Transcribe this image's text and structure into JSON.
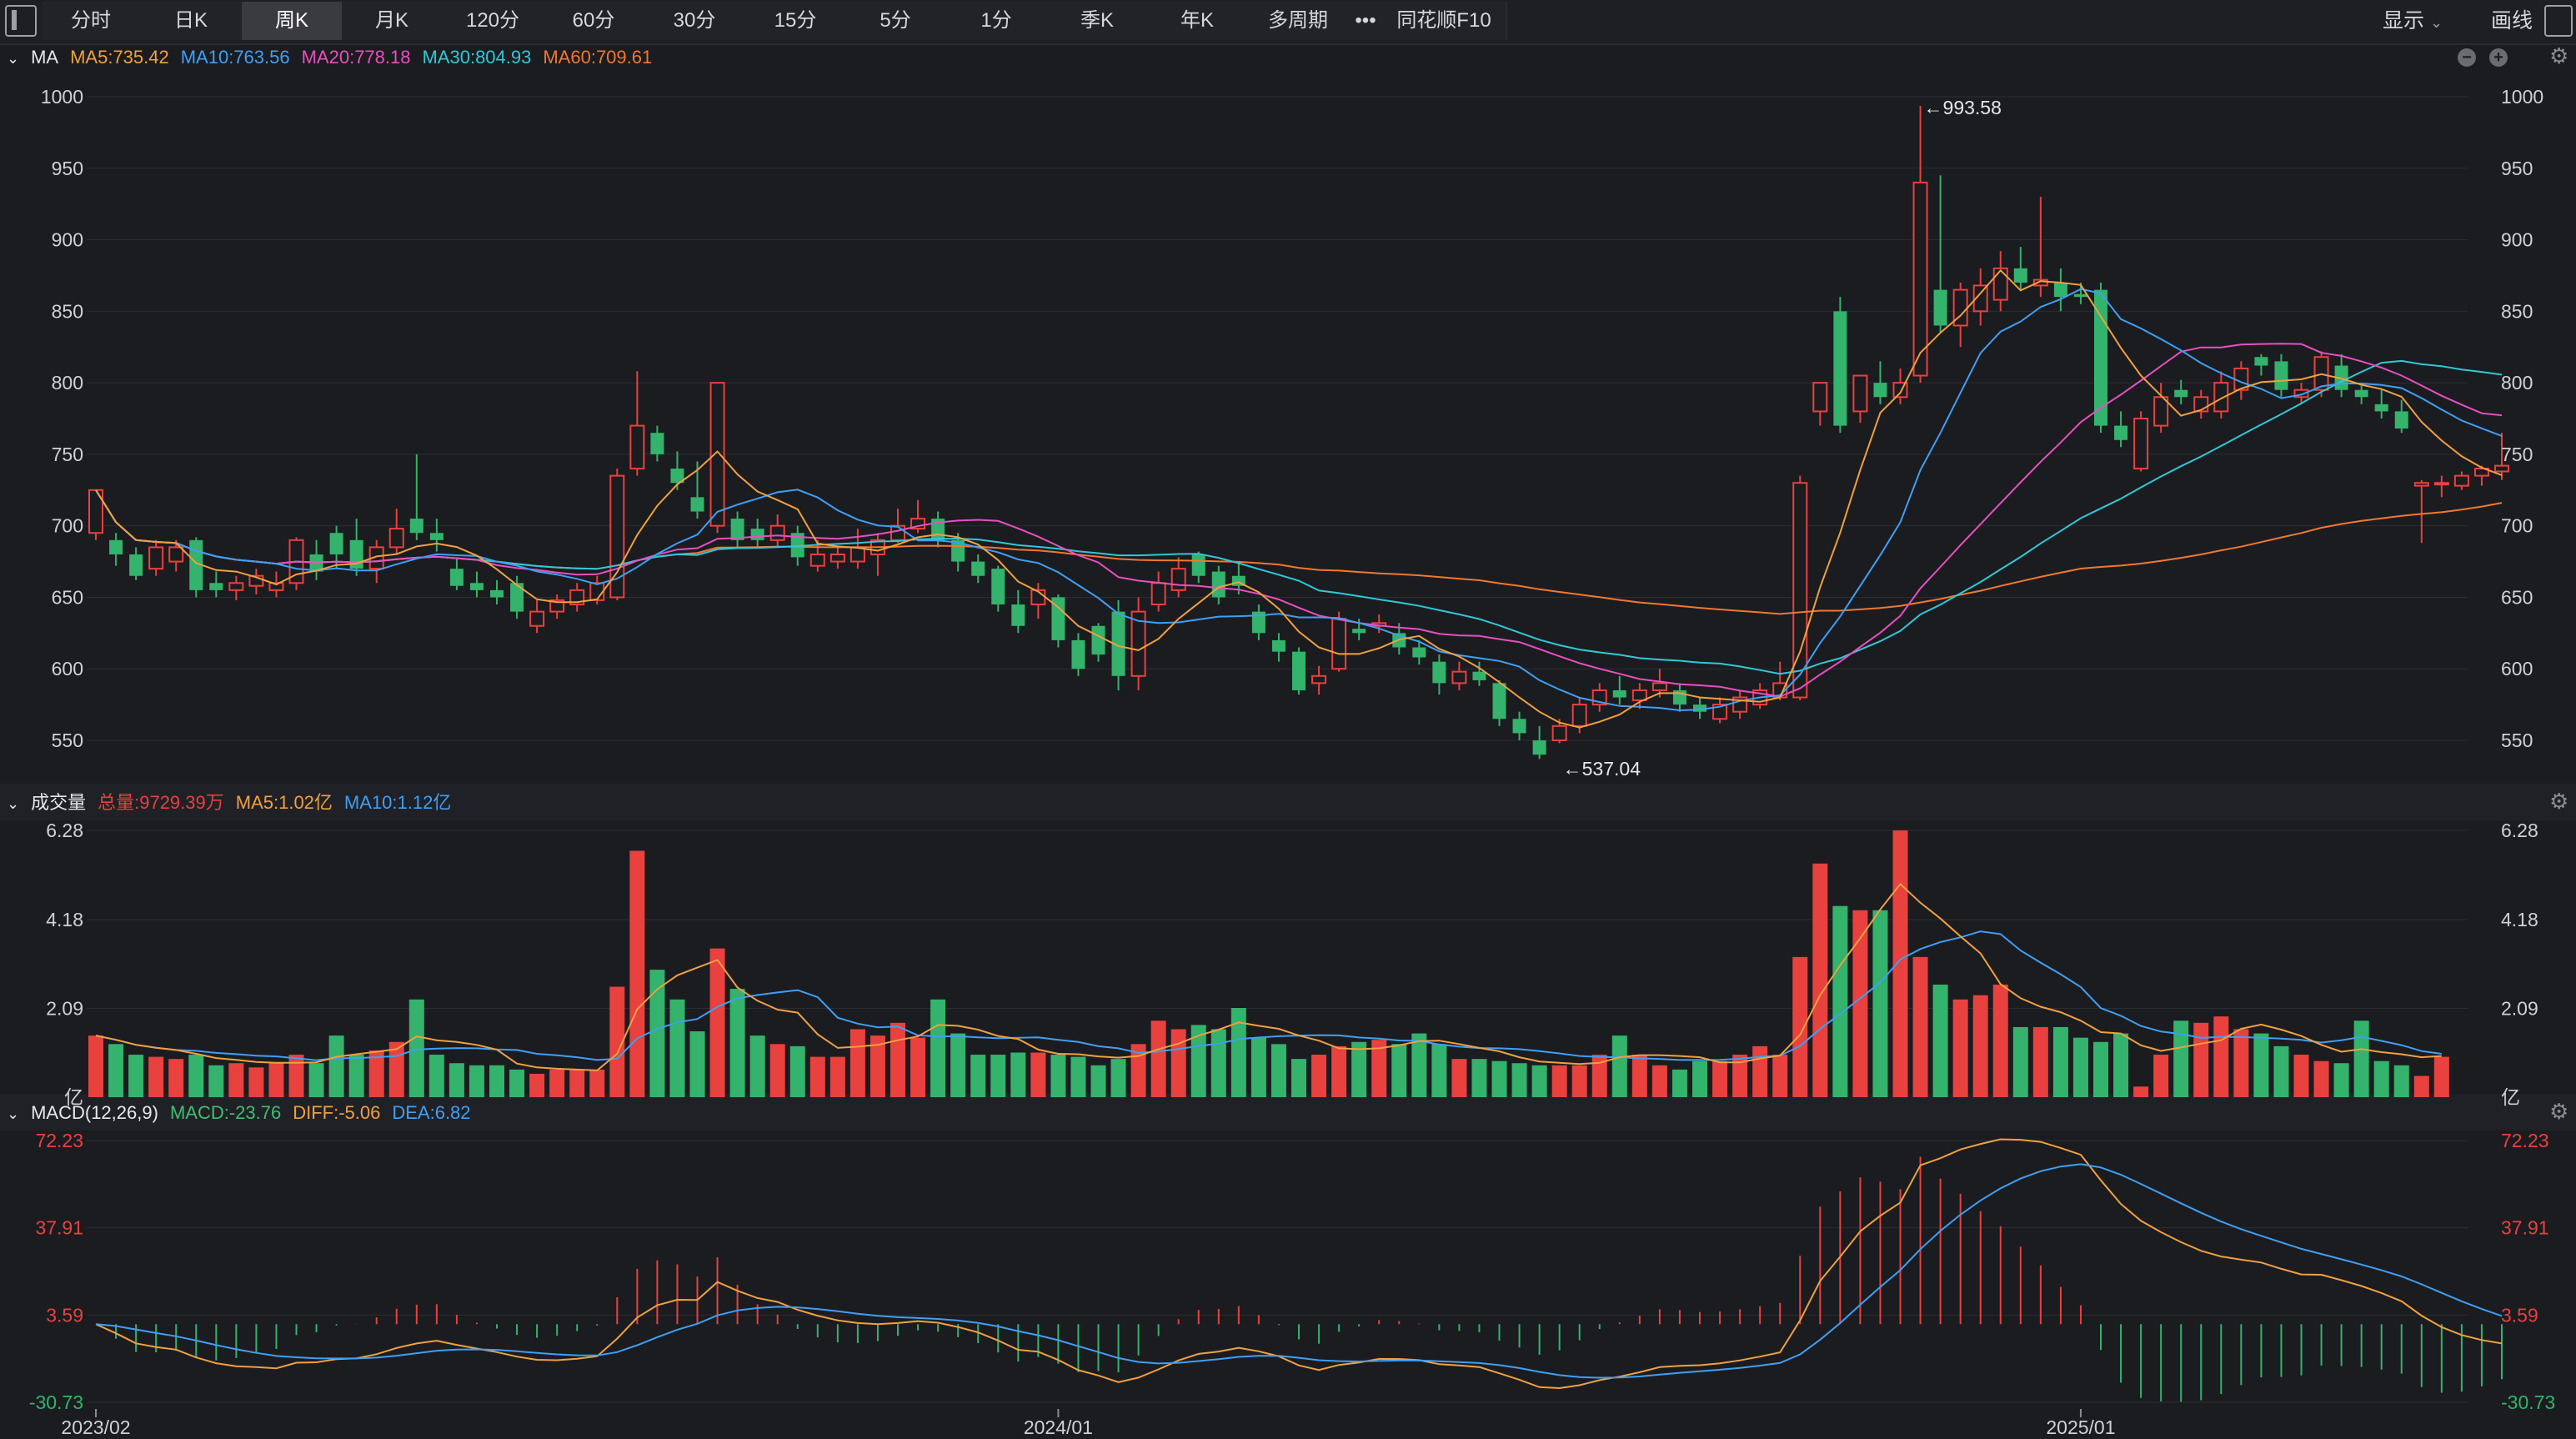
{
  "toolbar": {
    "tabs": [
      "分时",
      "日K",
      "周K",
      "月K",
      "120分",
      "60分",
      "30分",
      "15分",
      "5分",
      "1分",
      "季K",
      "年K",
      "多周期",
      "•••",
      "同花顺F10"
    ],
    "active_index": 2,
    "display_label": "显示",
    "draw_label": "画线"
  },
  "price_panel": {
    "title": "MA",
    "indicators": [
      {
        "label": "MA5:735.42",
        "color": "#f0a040"
      },
      {
        "label": "MA10:763.56",
        "color": "#3f9ff5"
      },
      {
        "label": "MA20:778.18",
        "color": "#e84fc0"
      },
      {
        "label": "MA30:804.93",
        "color": "#30c8d8"
      },
      {
        "label": "MA60:709.61",
        "color": "#f07830"
      }
    ]
  },
  "volume_panel": {
    "title": "成交量",
    "indicators": [
      {
        "label": "总量:9729.39万",
        "color": "#e8413e"
      },
      {
        "label": "MA5:1.02亿",
        "color": "#f0a040"
      },
      {
        "label": "MA10:1.12亿",
        "color": "#3f9ff5"
      }
    ]
  },
  "macd_panel": {
    "title": "MACD(12,26,9)",
    "indicators": [
      {
        "label": "MACD:-23.76",
        "color": "#3fbf70"
      },
      {
        "label": "DIFF:-5.06",
        "color": "#f0a040"
      },
      {
        "label": "DEA:6.82",
        "color": "#3f9ff5"
      }
    ]
  },
  "colors": {
    "up": "#e8413e",
    "down": "#33b36b",
    "grid": "#2c2d33",
    "axis_text": "#d0d1d5",
    "ma5": "#f0a040",
    "ma10": "#3f9ff5",
    "ma20": "#e84fc0",
    "ma30": "#30c8d8",
    "ma60": "#f07830"
  },
  "chart_data": {
    "type": "candlestick",
    "period": "weekly",
    "price_axis": {
      "ticks": [
        "1000",
        "950",
        "900",
        "850",
        "800",
        "750",
        "700",
        "650",
        "600",
        "550"
      ],
      "ylim": [
        525,
        1010
      ]
    },
    "volume_axis": {
      "ticks": [
        "6.28",
        "4.18",
        "2.09",
        "亿"
      ],
      "unit": "亿",
      "ylim": [
        0,
        6.28
      ]
    },
    "macd_axis": {
      "ticks": [
        "72.23",
        "37.91",
        "3.59",
        "-30.73"
      ],
      "ylim": [
        -30.73,
        72.23
      ]
    },
    "x_axis": {
      "labels": [
        {
          "text": "2023/02",
          "index": 0
        },
        {
          "text": "2024/01",
          "index": 48
        },
        {
          "text": "2025/01",
          "index": 99
        }
      ]
    },
    "annotations": [
      {
        "text": "←993.58",
        "index": 91,
        "value": 993.58,
        "kind": "high"
      },
      {
        "text": "←537.04",
        "index": 73,
        "value": 537.04,
        "kind": "low"
      }
    ],
    "candles": [
      [
        695,
        725,
        725,
        690
      ],
      [
        690,
        680,
        695,
        672
      ],
      [
        680,
        665,
        685,
        662
      ],
      [
        670,
        685,
        690,
        665
      ],
      [
        675,
        685,
        690,
        668
      ],
      [
        690,
        655,
        692,
        650
      ],
      [
        660,
        655,
        668,
        650
      ],
      [
        655,
        660,
        665,
        648
      ],
      [
        658,
        665,
        670,
        652
      ],
      [
        655,
        660,
        668,
        650
      ],
      [
        660,
        690,
        692,
        655
      ],
      [
        680,
        668,
        690,
        662
      ],
      [
        695,
        680,
        700,
        670
      ],
      [
        690,
        670,
        705,
        665
      ],
      [
        670,
        685,
        690,
        660
      ],
      [
        685,
        698,
        712,
        680
      ],
      [
        705,
        695,
        750,
        690
      ],
      [
        695,
        690,
        705,
        682
      ],
      [
        670,
        658,
        678,
        655
      ],
      [
        660,
        655,
        668,
        650
      ],
      [
        655,
        650,
        662,
        645
      ],
      [
        660,
        640,
        665,
        635
      ],
      [
        630,
        640,
        648,
        625
      ],
      [
        640,
        648,
        652,
        635
      ],
      [
        645,
        655,
        660,
        640
      ],
      [
        648,
        660,
        665,
        645
      ],
      [
        650,
        735,
        740,
        648
      ],
      [
        740,
        770,
        808,
        735
      ],
      [
        765,
        750,
        770,
        745
      ],
      [
        740,
        730,
        752,
        725
      ],
      [
        720,
        710,
        745,
        705
      ],
      [
        700,
        800,
        800,
        695
      ],
      [
        705,
        690,
        710,
        685
      ],
      [
        698,
        690,
        705,
        685
      ],
      [
        690,
        700,
        708,
        685
      ],
      [
        695,
        678,
        700,
        672
      ],
      [
        672,
        680,
        690,
        668
      ],
      [
        675,
        680,
        685,
        670
      ],
      [
        675,
        685,
        698,
        670
      ],
      [
        680,
        690,
        695,
        665
      ],
      [
        690,
        700,
        712,
        688
      ],
      [
        698,
        705,
        718,
        695
      ],
      [
        705,
        690,
        710,
        685
      ],
      [
        690,
        675,
        695,
        668
      ],
      [
        675,
        665,
        680,
        660
      ],
      [
        670,
        645,
        672,
        640
      ],
      [
        645,
        630,
        655,
        625
      ],
      [
        645,
        655,
        660,
        635
      ],
      [
        650,
        620,
        652,
        615
      ],
      [
        620,
        600,
        625,
        595
      ],
      [
        630,
        610,
        632,
        605
      ],
      [
        640,
        595,
        648,
        585
      ],
      [
        595,
        640,
        650,
        585
      ],
      [
        645,
        660,
        668,
        640
      ],
      [
        655,
        670,
        678,
        650
      ],
      [
        680,
        665,
        682,
        660
      ],
      [
        668,
        650,
        672,
        645
      ],
      [
        665,
        658,
        675,
        652
      ],
      [
        640,
        625,
        645,
        620
      ],
      [
        620,
        612,
        625,
        605
      ],
      [
        612,
        585,
        615,
        582
      ],
      [
        590,
        595,
        602,
        582
      ],
      [
        600,
        635,
        640,
        598
      ],
      [
        628,
        625,
        635,
        620
      ],
      [
        630,
        632,
        638,
        625
      ],
      [
        625,
        615,
        632,
        610
      ],
      [
        615,
        608,
        620,
        603
      ],
      [
        605,
        590,
        610,
        582
      ],
      [
        590,
        598,
        605,
        585
      ],
      [
        598,
        592,
        605,
        588
      ],
      [
        590,
        565,
        592,
        560
      ],
      [
        565,
        555,
        570,
        550
      ],
      [
        550,
        540,
        560,
        537
      ],
      [
        550,
        560,
        565,
        548
      ],
      [
        560,
        575,
        580,
        555
      ],
      [
        575,
        585,
        590,
        570
      ],
      [
        585,
        580,
        595,
        575
      ],
      [
        578,
        585,
        590,
        572
      ],
      [
        585,
        590,
        600,
        580
      ],
      [
        585,
        575,
        590,
        570
      ],
      [
        575,
        570,
        580,
        565
      ],
      [
        565,
        575,
        580,
        562
      ],
      [
        570,
        580,
        585,
        565
      ],
      [
        575,
        585,
        590,
        572
      ],
      [
        580,
        590,
        605,
        578
      ],
      [
        580,
        730,
        735,
        578
      ],
      [
        780,
        800,
        790,
        770
      ],
      [
        850,
        770,
        860,
        765
      ],
      [
        780,
        805,
        805,
        772
      ],
      [
        800,
        790,
        815,
        785
      ],
      [
        790,
        800,
        810,
        785
      ],
      [
        805,
        940,
        993.58,
        800
      ],
      [
        865,
        840,
        945,
        835
      ],
      [
        840,
        865,
        870,
        825
      ],
      [
        850,
        868,
        880,
        840
      ],
      [
        858,
        880,
        892,
        850
      ],
      [
        880,
        870,
        895,
        865
      ],
      [
        868,
        872,
        930,
        860
      ],
      [
        870,
        860,
        880,
        850
      ],
      [
        862,
        860,
        870,
        855
      ],
      [
        865,
        770,
        870,
        765
      ],
      [
        770,
        760,
        780,
        755
      ],
      [
        740,
        775,
        780,
        738
      ],
      [
        770,
        790,
        800,
        765
      ],
      [
        795,
        790,
        802,
        785
      ],
      [
        780,
        790,
        795,
        775
      ],
      [
        780,
        800,
        808,
        775
      ],
      [
        795,
        810,
        815,
        788
      ],
      [
        818,
        812,
        820,
        805
      ],
      [
        815,
        795,
        820,
        790
      ],
      [
        790,
        795,
        800,
        785
      ],
      [
        795,
        818,
        822,
        790
      ],
      [
        812,
        795,
        820,
        790
      ],
      [
        795,
        790,
        800,
        785
      ],
      [
        785,
        780,
        795,
        775
      ],
      [
        780,
        768,
        788,
        765
      ],
      [
        728,
        730,
        732,
        688
      ],
      [
        730,
        730,
        735,
        720
      ],
      [
        728,
        735,
        738,
        725
      ],
      [
        735,
        740,
        742,
        728
      ],
      [
        738,
        742,
        765,
        732
      ]
    ],
    "volumes": [
      1.45,
      1.25,
      1.0,
      0.95,
      0.9,
      1.0,
      0.75,
      0.8,
      0.7,
      0.8,
      1.0,
      0.8,
      1.45,
      1.0,
      1.1,
      1.3,
      2.3,
      1.0,
      0.8,
      0.75,
      0.75,
      0.65,
      0.55,
      0.65,
      0.65,
      0.65,
      2.6,
      5.8,
      3.0,
      2.3,
      1.55,
      3.5,
      2.55,
      1.45,
      1.25,
      1.2,
      0.95,
      0.95,
      1.6,
      1.45,
      1.75,
      1.4,
      2.3,
      1.5,
      1.0,
      1.0,
      1.05,
      1.05,
      1.0,
      0.95,
      0.75,
      0.9,
      1.25,
      1.8,
      1.6,
      1.7,
      1.6,
      2.1,
      1.4,
      1.25,
      0.9,
      1.0,
      1.2,
      1.3,
      1.35,
      1.25,
      1.5,
      1.25,
      0.9,
      0.9,
      0.85,
      0.8,
      0.75,
      0.75,
      0.75,
      1.0,
      1.45,
      1.0,
      0.75,
      0.65,
      0.85,
      0.85,
      1.0,
      1.2,
      1.0,
      3.3,
      5.5,
      4.5,
      4.4,
      4.4,
      6.28,
      3.3,
      2.65,
      2.3,
      2.4,
      2.65,
      1.65,
      1.65,
      1.65,
      1.4,
      1.3,
      1.5,
      0.25,
      1.0,
      1.8,
      1.75,
      1.9,
      1.6,
      1.5,
      1.2,
      1.0,
      0.85,
      0.8,
      1.8,
      0.85,
      0.75,
      0.5,
      0.95
    ]
  }
}
